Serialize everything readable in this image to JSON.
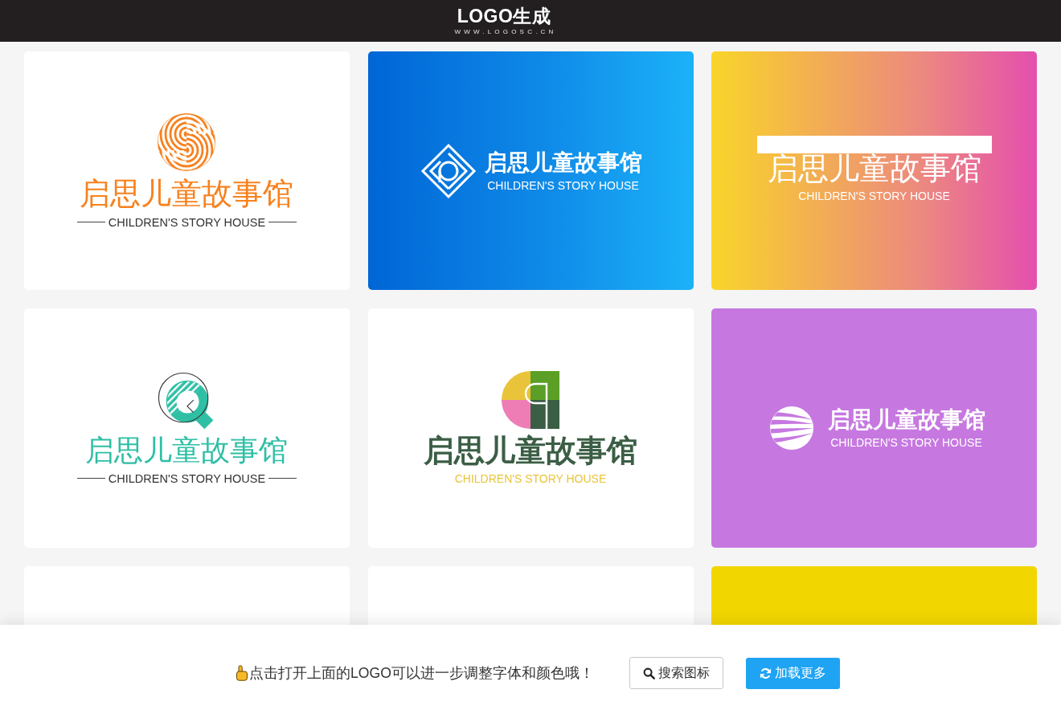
{
  "header": {
    "logo": "LOGO生成",
    "url": "WWW.LOGOSC.CN"
  },
  "cards": [
    {
      "kind": "swirl",
      "color": "#ffffff",
      "name": "启思儿童故事馆",
      "tagline": "CHILDREN'S STORY HOUSE"
    },
    {
      "kind": "diamond",
      "name": "启思儿童故事馆",
      "tagline": "CHILDREN'S STORY HOUSE"
    },
    {
      "kind": "banner",
      "name": "启思儿童故事馆",
      "tagline": "CHILDREN'S STORY HOUSE"
    },
    {
      "kind": "ring",
      "color": "#ffffff",
      "name": "启思儿童故事馆",
      "tagline": "CHILDREN'S STORY HOUSE"
    },
    {
      "kind": "blocks",
      "color": "#ffffff",
      "name": "启思儿童故事馆",
      "tagline": "CHILDREN'S STORY HOUSE"
    },
    {
      "kind": "sphere",
      "color": "#c678e0",
      "name": "启思儿童故事馆",
      "tagline": "CHILDREN'S STORY HOUSE"
    },
    {
      "kind": "blank",
      "color": "#ffffff"
    },
    {
      "kind": "blank",
      "color": "#ffffff"
    },
    {
      "kind": "blank",
      "color": "#f2d600"
    }
  ],
  "footer": {
    "hint": "点击打开上面的LOGO可以进一步调整字体和颜色哦！",
    "buttons": [
      {
        "kind": "search",
        "label": "搜索图标"
      },
      {
        "kind": "refresh",
        "label": "加载更多"
      }
    ]
  }
}
